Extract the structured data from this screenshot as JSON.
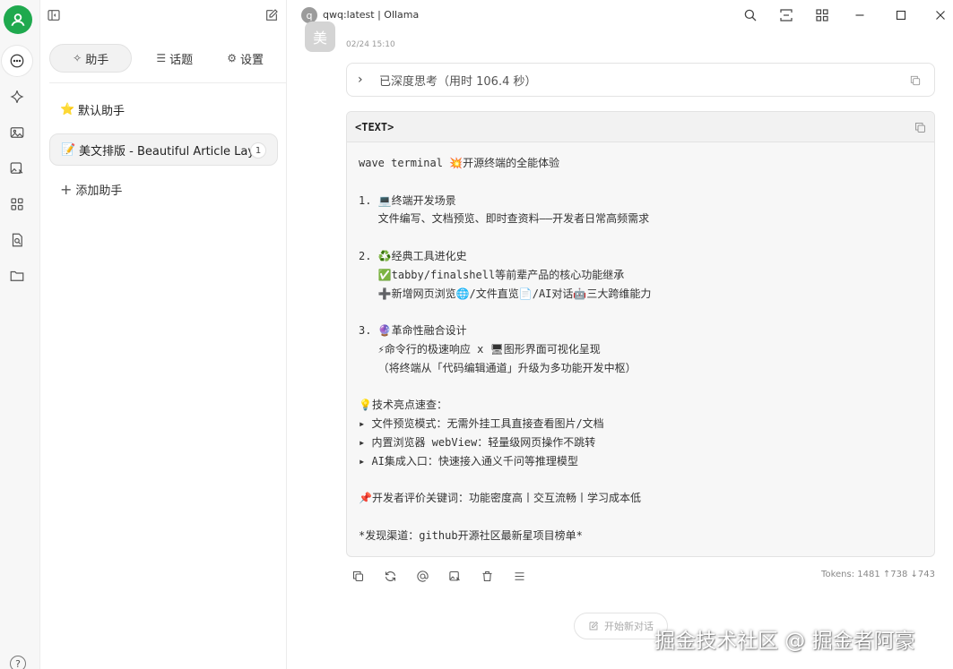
{
  "header": {
    "model_initial": "q",
    "model_name": "qwq:latest | Ollama"
  },
  "tabs": [
    {
      "label": "助手",
      "icon": "sparkle-icon",
      "active": true
    },
    {
      "label": "话题",
      "icon": "list-icon",
      "active": false
    },
    {
      "label": "设置",
      "icon": "gear-icon",
      "active": false
    }
  ],
  "assistants": [
    {
      "emoji": "⭐",
      "label": "默认助手"
    },
    {
      "emoji": "📝",
      "label": "美文排版 - Beautiful Article Layout",
      "badge": "1"
    }
  ],
  "add_assistant_label": "添加助手",
  "message": {
    "avatar_char": "美",
    "time": "02/24 15:10",
    "thinking_label": "已深度思考（用时 106.4 秒）",
    "code_lang": "<TEXT>",
    "code_lines": [
      "wave terminal 💥开源终端的全能体验",
      "",
      "1. 💻终端开发场景",
      "   文件编写、文档预览、即时查资料——开发者日常高频需求",
      "",
      "2. ♻️经典工具进化史",
      "   ✅tabby/finalshell等前辈产品的核心功能继承",
      "   ➕新增网页浏览🌐/文件直览📄/AI对话🤖三大跨维能力",
      "",
      "3. 🔮革命性融合设计",
      "   ⚡命令行的极速响应 x 🖥图形界面可视化呈现",
      "   （将终端从「代码编辑通道」升级为多功能开发中枢）",
      "",
      "💡技术亮点速查：",
      "▸ 文件预览模式：无需外挂工具直接查看图片/文档",
      "▸ 内置浏览器 webView：轻量级网页操作不跳转",
      "▸ AI集成入口：快速接入通义千问等推理模型",
      "",
      "📌开发者评价关键词：功能密度高丨交互流畅丨学习成本低",
      "",
      "*发现渠道：github开源社区最新星项目榜单*"
    ],
    "tokens": "Tokens: 1481 ↑738 ↓743"
  },
  "new_chat_label": "开始新对话",
  "watermark": "掘金技术社区 @ 掘金者阿豪",
  "help_label": "?",
  "colors": {
    "brand": "#1fa94e"
  }
}
